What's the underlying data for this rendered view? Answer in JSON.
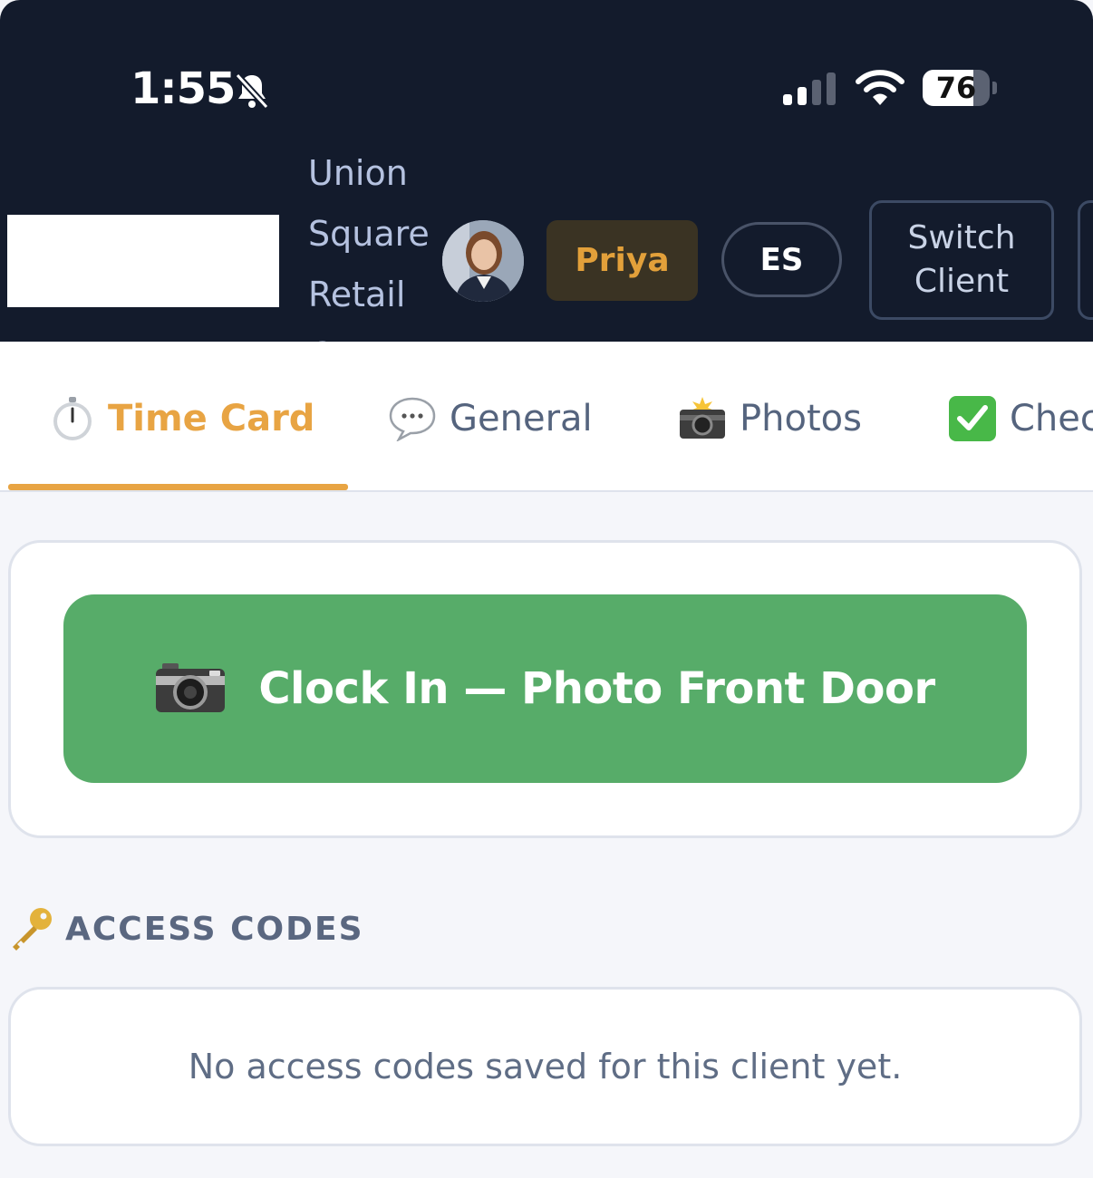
{
  "status_bar": {
    "time": "1:55",
    "battery": "76",
    "icons": [
      "bell-slash-icon",
      "cellular-signal-icon",
      "wifi-icon",
      "battery-icon"
    ]
  },
  "header": {
    "client_name": "Union Square Retail Center",
    "user": "Priya",
    "language": "ES",
    "switch_client": "Switch Client",
    "colors": {
      "background": "#131b2c",
      "accent": "#e8a443"
    }
  },
  "tabs": [
    {
      "label": "Time Card",
      "icon": "stopwatch-icon",
      "active": true
    },
    {
      "label": "General",
      "icon": "speech-bubble-icon",
      "active": false
    },
    {
      "label": "Photos",
      "icon": "camera-flash-icon",
      "active": false
    },
    {
      "label": "Chec",
      "icon": "check-mark-icon",
      "active": false
    }
  ],
  "clock_in": {
    "label": "Clock In — Photo Front Door",
    "icon": "camera-icon",
    "color": "#57ac69"
  },
  "access_codes": {
    "title": "ACCESS CODES",
    "icon": "key-icon",
    "empty_text": "No access codes saved for this client yet."
  }
}
